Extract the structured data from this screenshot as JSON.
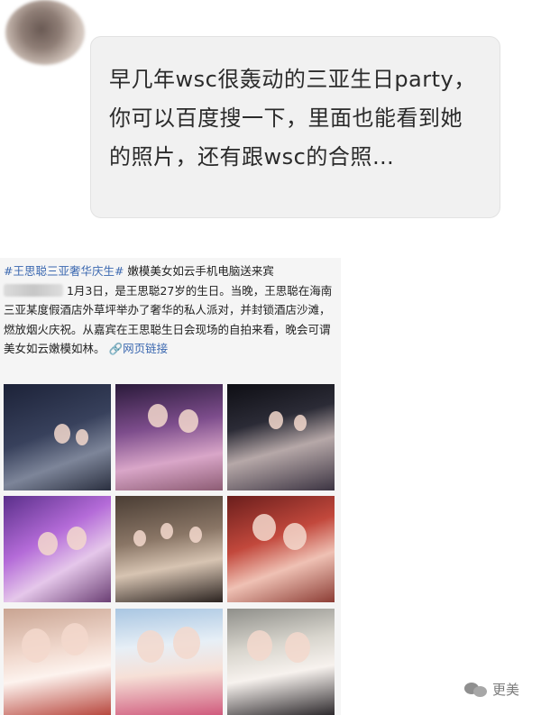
{
  "chat": {
    "message": "早几年wsc很轰动的三亚生日party，你可以百度搜一下，里面也能看到她的照片，还有跟wsc的合照…"
  },
  "post": {
    "hashtag": "#王思聪三亚奢华庆生#",
    "text_after_hashtag": " 嫩模美女如云手机电脑送来宾",
    "body": "1月3日，是王思聪27岁的生日。当晚，王思聪在海南三亚某度假酒店外草坪举办了奢华的私人派对，并封锁酒店沙滩，燃放烟火庆祝。从嘉宾在王思聪生日会现场的自拍来看，晚会可谓美女如云嫩模如林。",
    "link_label": "网页链接",
    "link_icon": "link-icon",
    "photos": [
      "party-photo",
      "party-photo",
      "party-photo",
      "party-photo",
      "party-photo",
      "party-photo",
      "party-photo",
      "party-photo",
      "party-photo"
    ]
  },
  "watermark": {
    "label": "更美",
    "icon": "wechat-icon"
  },
  "colors": {
    "bubble": "#f1f1f1",
    "link": "#3b68b0",
    "text": "#222222"
  }
}
